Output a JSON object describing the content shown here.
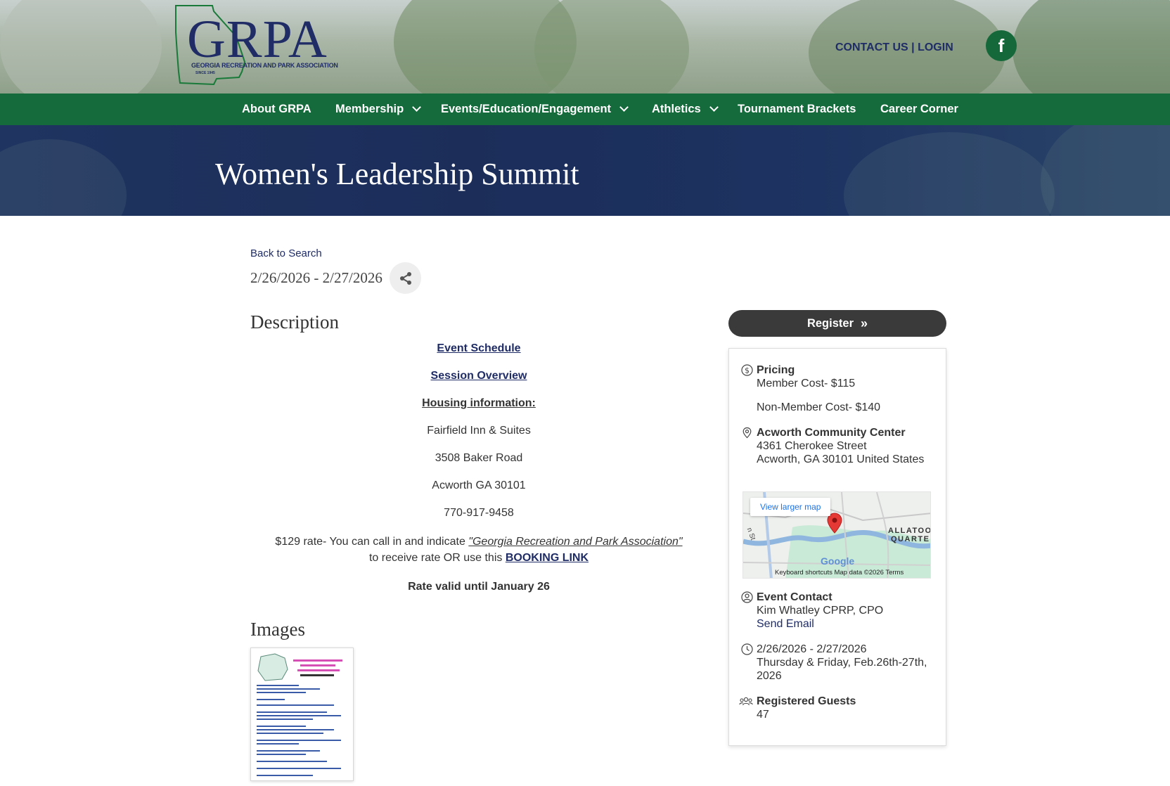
{
  "header": {
    "logo_text": "GRPA",
    "logo_subtitle": "GEORGIA RECREATION AND PARK ASSOCIATION",
    "logo_since": "SINCE 1945",
    "contact_label": "CONTACT US",
    "separator": " | ",
    "login_label": "LOGIN",
    "social_icon": "facebook-icon"
  },
  "nav": {
    "items": [
      {
        "label": "About GRPA",
        "dropdown": false
      },
      {
        "label": "Membership",
        "dropdown": true
      },
      {
        "label": "Events/Education/Engagement",
        "dropdown": true
      },
      {
        "label": "Athletics",
        "dropdown": true
      },
      {
        "label": "Tournament Brackets",
        "dropdown": false
      },
      {
        "label": "Career Corner",
        "dropdown": false
      }
    ]
  },
  "page": {
    "title": "Women's Leadership Summit",
    "back_label": "Back to Search",
    "date_range": "2/26/2026 - 2/27/2026"
  },
  "description": {
    "heading": "Description",
    "event_schedule": "Event Schedule",
    "session_overview": "Session Overview",
    "housing_heading": "Housing information:",
    "hotel_name": "Fairfield Inn & Suites",
    "hotel_street": "3508 Baker Road",
    "hotel_city": "Acworth GA 30101",
    "hotel_phone": "770-917-9458",
    "rate_prefix": "$129 rate- You can call in and indicate ",
    "rate_assoc": "\"Georgia Recreation and Park Association\"",
    "rate_middle": "to receive rate OR use this ",
    "booking_link": "BOOKING LINK",
    "rate_valid": "Rate valid until January 26"
  },
  "images": {
    "heading": "Images",
    "thumb_title": "Women's leadership Summit 2026 Feb 26th- 27th, 2026",
    "thumb_subtitle": "Schedule- Sessions",
    "thumb_badge": "Women"
  },
  "sidebar": {
    "register_label": "Register",
    "pricing_label": "Pricing",
    "member_cost": "Member Cost- $115",
    "non_member_cost": "Non-Member Cost- $140",
    "venue_name": "Acworth Community Center",
    "venue_street": "4361 Cherokee Street",
    "venue_city": "Acworth, GA 30101 United States",
    "map": {
      "view_larger": "View larger map",
      "area_label_1": "ALLATOO",
      "area_label_2": "QUARTEF",
      "street_label": "n St",
      "google": "Google",
      "footer": "Keyboard shortcuts   Map data ©2026    Terms"
    },
    "contact_label": "Event Contact",
    "contact_name": "Kim Whatley CPRP, CPO",
    "send_email": "Send Email",
    "dates": "2/26/2026 - 2/27/2026",
    "dates_note": "Thursday & Friday, Feb.26th-27th, 2026",
    "guests_label": "Registered Guests",
    "guests_count": "47"
  },
  "colors": {
    "brand_navy": "#1f2c66",
    "brand_green": "#166b3d",
    "register_bg": "#3a3a3a"
  }
}
